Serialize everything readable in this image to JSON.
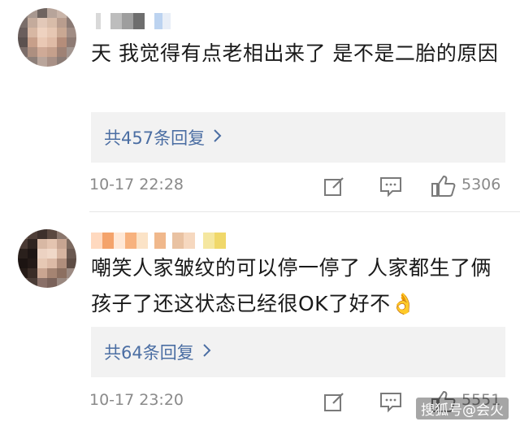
{
  "comments": [
    {
      "text": "天 我觉得有点老相出来了 是不是二胎的原因",
      "reply_label": "共457条回复",
      "time": "10-17 22:28",
      "likes": "5306"
    },
    {
      "text": "嘲笑人家皱纹的可以停一停了 人家都生了俩孩子了还这状态已经很OK了好不👌",
      "reply_label": "共64条回复",
      "time": "10-17 23:20",
      "likes": "5551"
    }
  ],
  "icons": {
    "chevron": "chevron-right-icon",
    "edit": "edit-icon",
    "comment": "comment-icon",
    "like": "thumbs-up-icon"
  },
  "watermark": "搜狐号@会火",
  "colors": {
    "reply_link": "#4b6ea3",
    "meta_text": "#8a8a8a",
    "reply_bg": "#f2f2f2"
  }
}
